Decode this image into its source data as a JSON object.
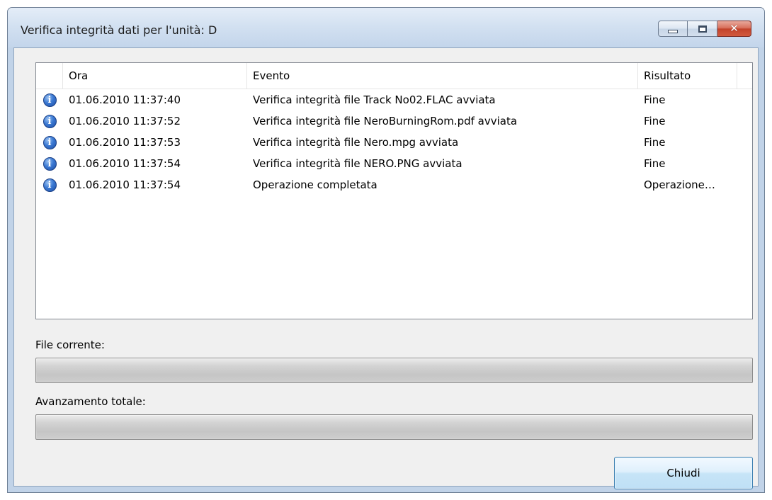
{
  "window": {
    "title": "Verifica integrità dati per l'unità: D",
    "close_glyph": "✕"
  },
  "list": {
    "columns": {
      "ora": "Ora",
      "evento": "Evento",
      "risultato": "Risultato"
    },
    "rows": [
      {
        "icon": "info-icon",
        "ora": "01.06.2010 11:37:40",
        "evento": "Verifica integrità file Track No02.FLAC avviata",
        "risultato": "Fine"
      },
      {
        "icon": "info-icon",
        "ora": "01.06.2010 11:37:52",
        "evento": "Verifica integrità file NeroBurningRom.pdf avviata",
        "risultato": "Fine"
      },
      {
        "icon": "info-icon",
        "ora": "01.06.2010 11:37:53",
        "evento": "Verifica integrità file Nero.mpg avviata",
        "risultato": "Fine"
      },
      {
        "icon": "info-icon",
        "ora": "01.06.2010 11:37:54",
        "evento": "Verifica integrità file NERO.PNG avviata",
        "risultato": "Fine"
      },
      {
        "icon": "info-icon",
        "ora": "01.06.2010 11:37:54",
        "evento": "Operazione completata",
        "risultato": "Operazione…"
      }
    ]
  },
  "current_file": {
    "label": "File corrente:",
    "progress": 1.0
  },
  "total_progress": {
    "label": "Avanzamento totale:",
    "progress": 1.0
  },
  "buttons": {
    "close_label": "Chiudi"
  },
  "icon_glyph": "i"
}
